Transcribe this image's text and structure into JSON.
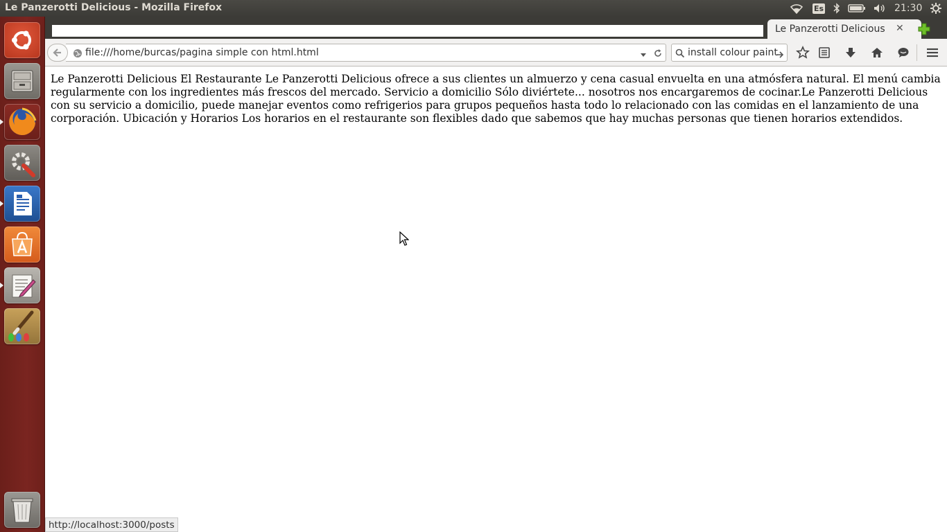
{
  "system": {
    "window_title": "Le Panzerotti Delicious - Mozilla Firefox",
    "keyboard_layout": "Es",
    "clock": "21:30"
  },
  "browser": {
    "tab_title": "Le Panzerotti Delicious",
    "url": "file:///home/burcas/pagina simple con html.html",
    "search_value": "install colour paint"
  },
  "page": {
    "text": "Le Panzerotti Delicious El Restaurante Le Panzerotti Delicious ofrece a sus clientes un almuerzo y cena casual envuelta en una atmósfera natural. El menú cambia regularmente con los ingredientes más frescos del mercado. Servicio a domicilio Sólo diviértete... nosotros nos encargaremos de cocinar.Le Panzerotti Delicious con su servicio a domicilio, puede manejar eventos como refrigerios para grupos pequeños hasta todo lo relacionado con las comidas en el lanzamiento de una corporación. Ubicación y Horarios Los horarios en el restaurante son flexibles dado que sabemos que hay muchas personas que tienen horarios extendidos."
  },
  "status_bar": {
    "link": "http://localhost:3000/posts"
  },
  "launcher": {
    "items": [
      "ubuntu-dash-icon",
      "files-icon",
      "firefox-icon",
      "system-settings-icon",
      "libreoffice-writer-icon",
      "software-center-icon",
      "text-editor-icon",
      "paint-icon",
      "trash-icon"
    ]
  },
  "colors": {
    "launcher_bg": "#7a2520",
    "panel_bg": "#3c3b37",
    "chrome_bg": "#f2f1f0"
  }
}
